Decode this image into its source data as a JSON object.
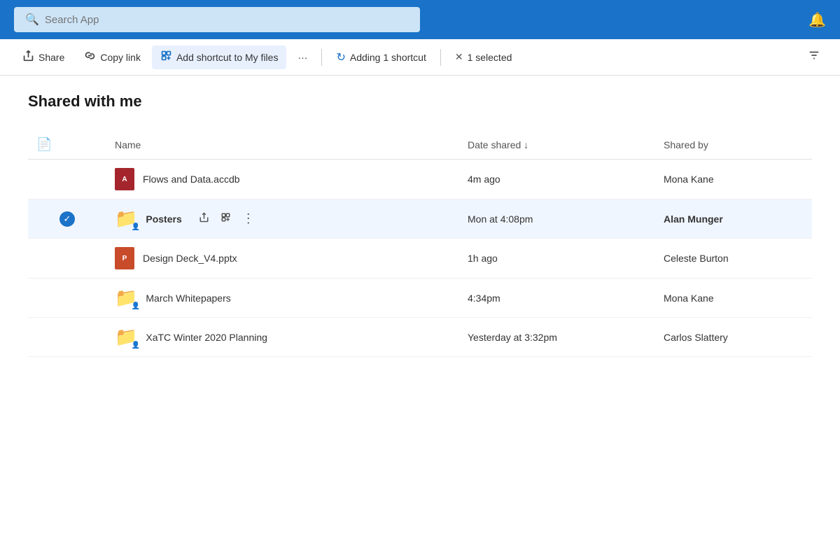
{
  "topbar": {
    "search_placeholder": "Search App",
    "bell_icon": "🔔"
  },
  "toolbar": {
    "share_label": "Share",
    "copy_link_label": "Copy link",
    "add_shortcut_label": "Add shortcut to My files",
    "more_label": "···",
    "adding_shortcut_label": "Adding 1 shortcut",
    "selected_label": "1 selected",
    "share_icon": "↗",
    "copy_link_icon": "🔗",
    "add_shortcut_icon": "⬛",
    "adding_icon": "↻",
    "close_icon": "✕",
    "sort_icon": "↕"
  },
  "main": {
    "page_title": "Shared with me",
    "table": {
      "headers": {
        "name": "Name",
        "date_shared": "Date shared ↓",
        "shared_by": "Shared by"
      },
      "rows": [
        {
          "id": 1,
          "icon_type": "access",
          "icon_label": "A",
          "name": "Flows and Data.accdb",
          "date_shared": "4m ago",
          "shared_by": "Mona Kane",
          "selected": false,
          "bold": false
        },
        {
          "id": 2,
          "icon_type": "folder-shared",
          "icon_label": "📁",
          "name": "Posters",
          "date_shared": "Mon at 4:08pm",
          "shared_by": "Alan Munger",
          "selected": true,
          "bold": true
        },
        {
          "id": 3,
          "icon_type": "powerpoint",
          "icon_label": "P",
          "name": "Design Deck_V4.pptx",
          "date_shared": "1h ago",
          "shared_by": "Celeste Burton",
          "selected": false,
          "bold": false
        },
        {
          "id": 4,
          "icon_type": "folder-shared",
          "icon_label": "📁",
          "name": "March Whitepapers",
          "date_shared": "4:34pm",
          "shared_by": "Mona Kane",
          "selected": false,
          "bold": false
        },
        {
          "id": 5,
          "icon_type": "folder-shared",
          "icon_label": "📁",
          "name": "XaTC Winter 2020 Planning",
          "date_shared": "Yesterday at 3:32pm",
          "shared_by": "Carlos Slattery",
          "selected": false,
          "bold": false
        }
      ]
    }
  }
}
